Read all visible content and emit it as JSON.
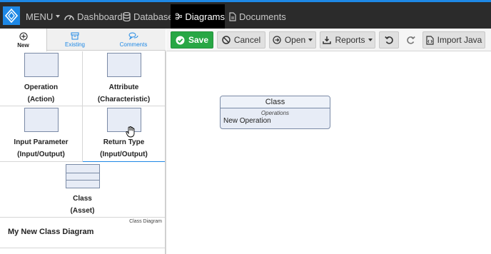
{
  "nav": {
    "menu": "MENU",
    "items": [
      {
        "label": "Dashboard",
        "icon": "dashboard-icon"
      },
      {
        "label": "Database",
        "icon": "database-icon"
      },
      {
        "label": "Diagrams",
        "icon": "diagram-icon",
        "active": true
      },
      {
        "label": "Documents",
        "icon": "document-icon"
      }
    ],
    "accent_color": "#1e88e5"
  },
  "left_panel": {
    "tabs": [
      {
        "label": "New",
        "icon": "plus-circle-icon",
        "active": true
      },
      {
        "label": "Existing",
        "icon": "archive-icon"
      },
      {
        "label": "Comments",
        "icon": "comments-icon"
      }
    ],
    "palette": [
      {
        "line1": "Operation",
        "line2": "(Action)"
      },
      {
        "line1": "Attribute",
        "line2": "(Characteristic)"
      },
      {
        "line1": "Input Parameter",
        "line2": "(Input/Output)"
      },
      {
        "line1": "Return Type",
        "line2": "(Input/Output)"
      },
      {
        "line1": "Class",
        "line2": "(Asset)"
      }
    ],
    "diagram": {
      "type": "Class Diagram",
      "name": "My New Class Diagram"
    }
  },
  "toolbar": {
    "save": "Save",
    "cancel": "Cancel",
    "open": "Open",
    "reports": "Reports",
    "import_java": "Import Java",
    "save_color": "#28a745"
  },
  "canvas": {
    "class_node": {
      "title": "Class",
      "section": "Operations",
      "operation": "New Operation"
    }
  }
}
